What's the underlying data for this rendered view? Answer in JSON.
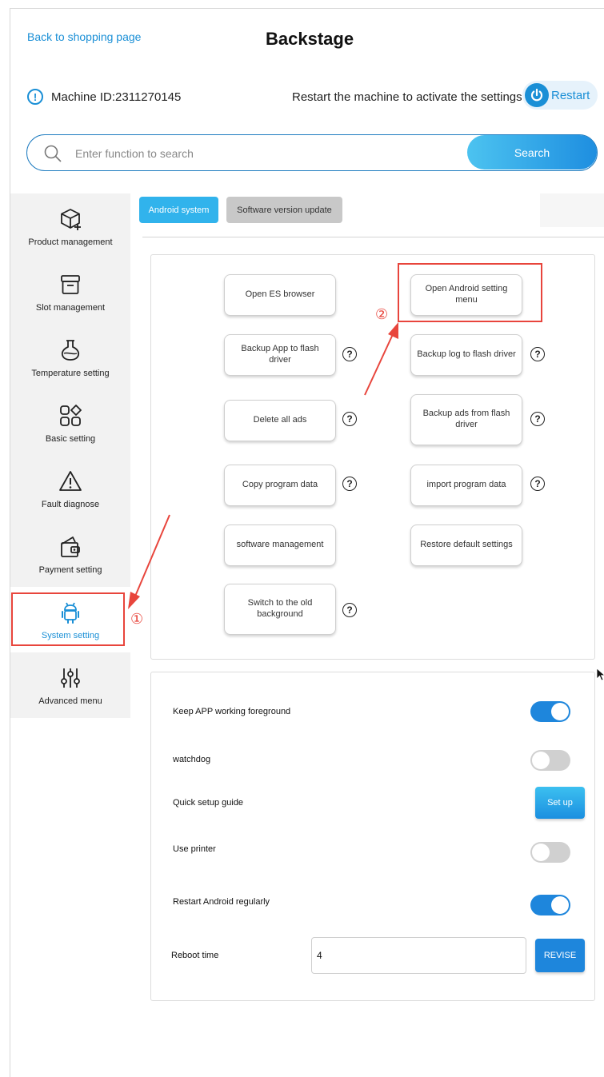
{
  "header": {
    "back_link": "Back to shopping page",
    "title": "Backstage"
  },
  "info": {
    "machine_id": "Machine ID:2311270145",
    "restart_hint": "Restart the machine to activate the settings",
    "restart_label": "Restart"
  },
  "search": {
    "placeholder": "Enter function to search",
    "button_label": "Search"
  },
  "sidebar": {
    "items": [
      {
        "label": "Product management",
        "icon": "box-plus-icon"
      },
      {
        "label": "Slot management",
        "icon": "drawer-icon"
      },
      {
        "label": "Temperature setting",
        "icon": "flask-icon"
      },
      {
        "label": "Basic setting",
        "icon": "grid-diamond-icon"
      },
      {
        "label": "Fault diagnose",
        "icon": "warning-icon"
      },
      {
        "label": "Payment setting",
        "icon": "wallet-icon"
      },
      {
        "label": "System setting",
        "icon": "android-icon"
      },
      {
        "label": "Advanced menu",
        "icon": "sliders-icon"
      }
    ],
    "active": "System setting"
  },
  "tabs": [
    {
      "label": "Android system",
      "active": true
    },
    {
      "label": "Software version update",
      "active": false
    }
  ],
  "functions": [
    {
      "label": "Open ES browser",
      "help": false
    },
    {
      "label": "Open Android setting menu",
      "help": false
    },
    {
      "label": "Backup App to flash driver",
      "help": true
    },
    {
      "label": "Backup log to flash driver",
      "help": true
    },
    {
      "label": "Delete all ads",
      "help": true
    },
    {
      "label": "Backup ads from flash driver",
      "help": true
    },
    {
      "label": "Copy program data",
      "help": true
    },
    {
      "label": "import program data",
      "help": true
    },
    {
      "label": "software management",
      "help": false
    },
    {
      "label": "Restore default settings",
      "help": false
    },
    {
      "label": "Switch to the old background",
      "help": true
    }
  ],
  "help_glyph": "?",
  "settings": {
    "keep_foreground": {
      "label": "Keep APP working foreground",
      "on": true
    },
    "watchdog": {
      "label": "watchdog",
      "on": false
    },
    "quick_setup": {
      "label": "Quick setup guide",
      "button": "Set up"
    },
    "use_printer": {
      "label": "Use printer",
      "on": false
    },
    "restart_regularly": {
      "label": "Restart Android regularly",
      "on": true
    },
    "reboot_time": {
      "label": "Reboot time",
      "value": "4",
      "button": "REVISE"
    }
  },
  "annotations": {
    "marker_1": "①",
    "marker_2": "②",
    "color": "#e8453c"
  },
  "colors": {
    "accent": "#1a8fd6",
    "toggle_on": "#1e86dc",
    "toggle_off": "#d0d0d0"
  }
}
